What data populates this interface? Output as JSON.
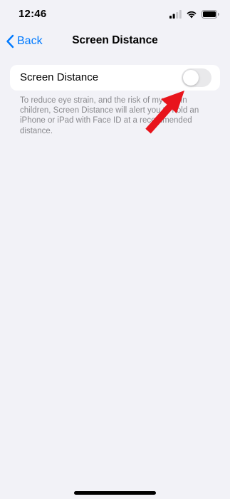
{
  "status_bar": {
    "time": "12:46",
    "icons": [
      "signal-icon",
      "wifi-icon",
      "battery-icon"
    ]
  },
  "nav": {
    "back_label": "Back",
    "title": "Screen Distance"
  },
  "settings": {
    "row_label": "Screen Distance",
    "toggle_on": false,
    "footer": "To reduce eye strain, and the risk of myopia in children, Screen Distance will alert you to hold an iPhone or iPad with Face ID at a recommended distance."
  },
  "colors": {
    "background": "#f2f2f7",
    "accent": "#007aff",
    "toggle_off": "#e9e9eb",
    "annotation_arrow": "#e8141c"
  }
}
